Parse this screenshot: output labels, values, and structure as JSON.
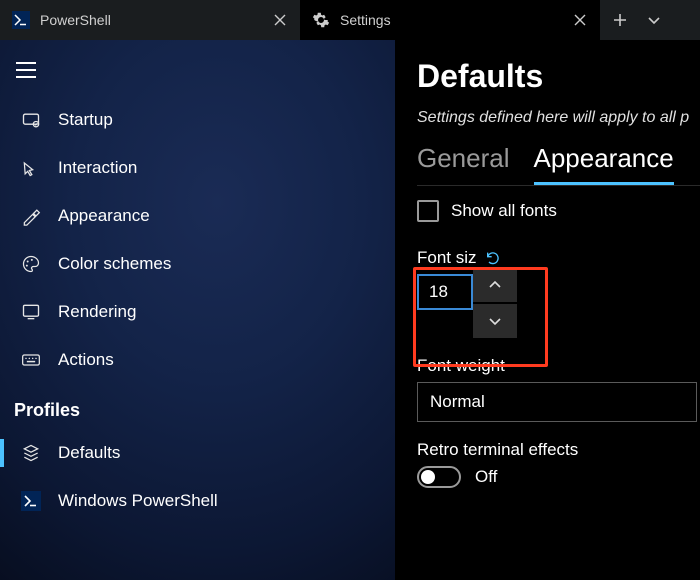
{
  "titlebar": {
    "tab_ps_label": "PowerShell",
    "tab_settings_label": "Settings"
  },
  "sidebar": {
    "items": [
      {
        "label": "Startup",
        "icon": "startup-icon"
      },
      {
        "label": "Interaction",
        "icon": "interaction-icon"
      },
      {
        "label": "Appearance",
        "icon": "appearance-icon"
      },
      {
        "label": "Color schemes",
        "icon": "palette-icon"
      },
      {
        "label": "Rendering",
        "icon": "rendering-icon"
      },
      {
        "label": "Actions",
        "icon": "keyboard-icon"
      }
    ],
    "profiles_header": "Profiles",
    "profiles": [
      {
        "label": "Defaults",
        "icon": "defaults-icon",
        "selected": true
      },
      {
        "label": "Windows PowerShell",
        "icon": "ps-icon"
      }
    ]
  },
  "content": {
    "title": "Defaults",
    "description": "Settings defined here will apply to all p",
    "tabs": {
      "general": "General",
      "appearance": "Appearance",
      "active": "appearance"
    },
    "show_all_fonts_label": "Show all fonts",
    "font_size_label": "Font siz",
    "font_size_value": "18",
    "font_weight_label": "Font weight",
    "font_weight_value": "Normal",
    "retro_label": "Retro terminal effects",
    "retro_value": "Off"
  }
}
